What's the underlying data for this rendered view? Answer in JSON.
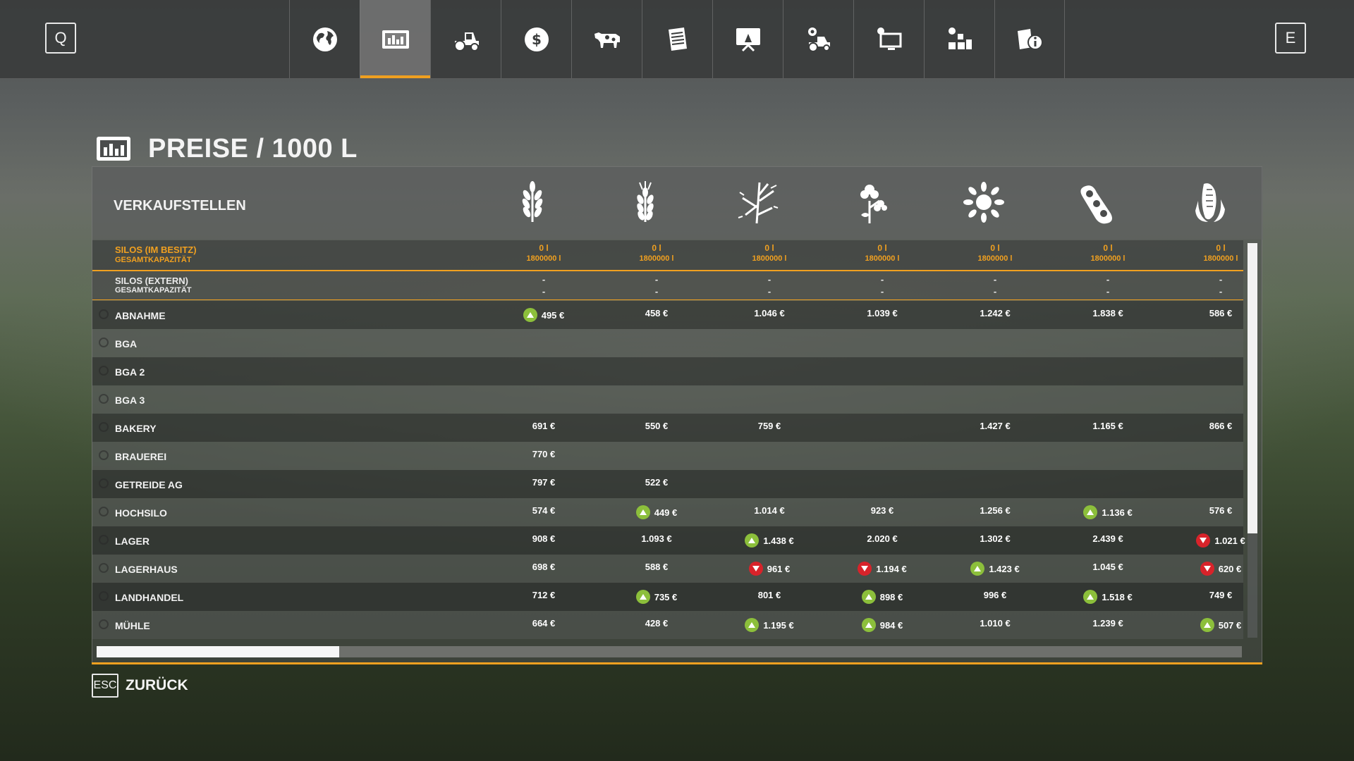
{
  "topbar": {
    "left_key": "Q",
    "right_key": "E",
    "tabs": [
      {
        "icon": "globe-icon",
        "active": false
      },
      {
        "icon": "prices-chart-icon",
        "active": true
      },
      {
        "icon": "tractor-icon",
        "active": false
      },
      {
        "icon": "dollar-icon",
        "active": false
      },
      {
        "icon": "cow-icon",
        "active": false
      },
      {
        "icon": "contracts-icon",
        "active": false
      },
      {
        "icon": "help-screen-icon",
        "active": false
      },
      {
        "icon": "tractor-gear-icon",
        "active": false
      },
      {
        "icon": "monitor-settings-icon",
        "active": false
      },
      {
        "icon": "production-icon",
        "active": false
      },
      {
        "icon": "info-document-icon",
        "active": false
      }
    ]
  },
  "page": {
    "title": "PREISE / 1000 L",
    "section_title": "VERKAUFSTELLEN"
  },
  "crops": [
    "wheat-icon",
    "barley-icon",
    "canola-icon",
    "cotton-icon",
    "sunflower-icon",
    "soybean-icon",
    "corn-icon"
  ],
  "silos_own": {
    "label": "SILOS (IM BESITZ)",
    "sublabel": "GESAMTKAPAZITÄT",
    "amounts": [
      "0 l",
      "0 l",
      "0 l",
      "0 l",
      "0 l",
      "0 l",
      "0 l"
    ],
    "capacities": [
      "1800000 l",
      "1800000 l",
      "1800000 l",
      "1800000 l",
      "1800000 l",
      "1800000 l",
      "1800000 l"
    ]
  },
  "silos_ext": {
    "label": "SILOS (EXTERN)",
    "sublabel": "GESAMTKAPAZITÄT",
    "amounts": [
      "-",
      "-",
      "-",
      "-",
      "-",
      "-",
      "-"
    ],
    "capacities": [
      "-",
      "-",
      "-",
      "-",
      "-",
      "-",
      "-"
    ]
  },
  "rows": [
    {
      "name": "ABNAHME",
      "cells": [
        {
          "v": "495 €",
          "t": "up"
        },
        {
          "v": "458 €"
        },
        {
          "v": "1.046 €"
        },
        {
          "v": "1.039 €"
        },
        {
          "v": "1.242 €"
        },
        {
          "v": "1.838 €"
        },
        {
          "v": "586 €"
        }
      ]
    },
    {
      "name": "BGA",
      "cells": [
        {
          "v": ""
        },
        {
          "v": ""
        },
        {
          "v": ""
        },
        {
          "v": ""
        },
        {
          "v": ""
        },
        {
          "v": ""
        },
        {
          "v": ""
        }
      ]
    },
    {
      "name": "BGA 2",
      "cells": [
        {
          "v": ""
        },
        {
          "v": ""
        },
        {
          "v": ""
        },
        {
          "v": ""
        },
        {
          "v": ""
        },
        {
          "v": ""
        },
        {
          "v": ""
        }
      ]
    },
    {
      "name": "BGA 3",
      "cells": [
        {
          "v": ""
        },
        {
          "v": ""
        },
        {
          "v": ""
        },
        {
          "v": ""
        },
        {
          "v": ""
        },
        {
          "v": ""
        },
        {
          "v": ""
        }
      ]
    },
    {
      "name": "BAKERY",
      "cells": [
        {
          "v": "691 €"
        },
        {
          "v": "550 €"
        },
        {
          "v": "759 €"
        },
        {
          "v": ""
        },
        {
          "v": "1.427 €"
        },
        {
          "v": "1.165 €"
        },
        {
          "v": "866 €"
        }
      ]
    },
    {
      "name": "BRAUEREI",
      "cells": [
        {
          "v": "770 €"
        },
        {
          "v": ""
        },
        {
          "v": ""
        },
        {
          "v": ""
        },
        {
          "v": ""
        },
        {
          "v": ""
        },
        {
          "v": ""
        }
      ]
    },
    {
      "name": "GETREIDE AG",
      "cells": [
        {
          "v": "797 €"
        },
        {
          "v": "522 €"
        },
        {
          "v": ""
        },
        {
          "v": ""
        },
        {
          "v": ""
        },
        {
          "v": ""
        },
        {
          "v": ""
        }
      ]
    },
    {
      "name": "HOCHSILO",
      "cells": [
        {
          "v": "574 €"
        },
        {
          "v": "449 €",
          "t": "up"
        },
        {
          "v": "1.014 €"
        },
        {
          "v": "923 €"
        },
        {
          "v": "1.256 €"
        },
        {
          "v": "1.136 €",
          "t": "up"
        },
        {
          "v": "576 €"
        }
      ]
    },
    {
      "name": "LAGER",
      "cells": [
        {
          "v": "908 €"
        },
        {
          "v": "1.093 €"
        },
        {
          "v": "1.438 €",
          "t": "up"
        },
        {
          "v": "2.020 €"
        },
        {
          "v": "1.302 €"
        },
        {
          "v": "2.439 €"
        },
        {
          "v": "1.021 €",
          "t": "down"
        }
      ]
    },
    {
      "name": "LAGERHAUS",
      "cells": [
        {
          "v": "698 €"
        },
        {
          "v": "588 €"
        },
        {
          "v": "961 €",
          "t": "down"
        },
        {
          "v": "1.194 €",
          "t": "down"
        },
        {
          "v": "1.423 €",
          "t": "up"
        },
        {
          "v": "1.045 €"
        },
        {
          "v": "620 €",
          "t": "down"
        }
      ]
    },
    {
      "name": "LANDHANDEL",
      "cells": [
        {
          "v": "712 €"
        },
        {
          "v": "735 €",
          "t": "up"
        },
        {
          "v": "801 €"
        },
        {
          "v": "898 €",
          "t": "up"
        },
        {
          "v": "996 €"
        },
        {
          "v": "1.518 €",
          "t": "up"
        },
        {
          "v": "749 €"
        }
      ]
    },
    {
      "name": "MÜHLE",
      "cells": [
        {
          "v": "664 €"
        },
        {
          "v": "428 €"
        },
        {
          "v": "1.195 €",
          "t": "up"
        },
        {
          "v": "984 €",
          "t": "up"
        },
        {
          "v": "1.010 €"
        },
        {
          "v": "1.239 €"
        },
        {
          "v": "507 €",
          "t": "up"
        }
      ]
    }
  ],
  "footer": {
    "esc_key": "ESC",
    "back_label": "ZURÜCK"
  },
  "colors": {
    "accent": "#f0a020",
    "trend_up": "#8cbf3b",
    "trend_down": "#d8232a"
  }
}
